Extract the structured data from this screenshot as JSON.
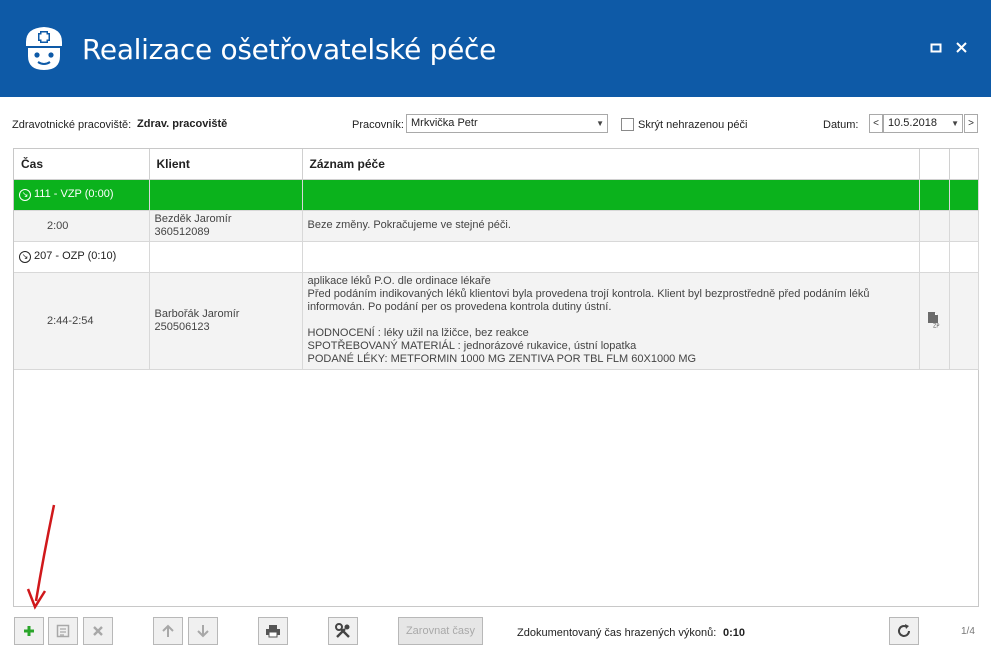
{
  "window": {
    "title": "Realizace ošetřovatelské péče",
    "restore_icon": "restore-icon",
    "close_icon": "close-icon"
  },
  "filters": {
    "workplace_label": "Zdravotnické pracoviště:",
    "workplace_value": "Zdrav. pracoviště",
    "worker_label": "Pracovník:",
    "worker_value": "Mrkvička Petr",
    "hide_unpaid_label": "Skrýt nehrazenou péči",
    "hide_unpaid_checked": false,
    "date_label": "Datum:",
    "date_prev": "<",
    "date_value": "10.5.2018",
    "date_next": ">"
  },
  "grid": {
    "columns": [
      "Čas",
      "Klient",
      "Záznam péče",
      "",
      ""
    ],
    "groups": [
      {
        "label": "111 - VZP (0:00)",
        "highlighted": true,
        "rows": [
          {
            "time": "2:00",
            "client_name": "Bezděk Jaromír",
            "client_id": "360512089",
            "note_lines": [
              "Beze změny. Pokračujeme ve stejné péči."
            ],
            "has_doc": false
          }
        ]
      },
      {
        "label": "207 - OZP (0:10)",
        "highlighted": false,
        "rows": [
          {
            "time": "2:44-2:54",
            "client_name": "Barbořák Jaromír",
            "client_id": "250506123",
            "note_lines": [
              "aplikace léků P.O. dle ordinace lékaře",
              "Před podáním indikovaných léků klientovi byla provedena trojí kontrola. Klient byl bezprostředně před podáním léků",
              "informován. Po podání per os provedena kontrola dutiny ústní.",
              "",
              "HODNOCENÍ : léky užil na lžičce, bez reakce",
              "SPOTŘEBOVANÝ MATERIÁL : jednorázové rukavice, ústní lopatka",
              "PODANÉ LÉKY: METFORMIN 1000 MG ZENTIVA POR TBL FLM 60X1000 MG"
            ],
            "has_doc": true
          }
        ]
      }
    ]
  },
  "toolbar": {
    "add_icon": "plus-icon",
    "edit_icon": "edit-icon",
    "delete_icon": "delete-icon",
    "up_icon": "arrow-up-icon",
    "down_icon": "arrow-down-icon",
    "print_icon": "print-icon",
    "settings_icon": "tools-icon",
    "align_times_label": "Zarovnat časy",
    "refresh_icon": "refresh-icon"
  },
  "status": {
    "documented_label": "Zdokumentovaný čas hrazených výkonů:",
    "documented_value": "0:10",
    "pager": "1/4"
  },
  "colors": {
    "titlebar": "#0e5aa7",
    "group_highlight": "#0bb21c",
    "add_green": "#2aa52a",
    "annotation_arrow": "#d0181b"
  }
}
